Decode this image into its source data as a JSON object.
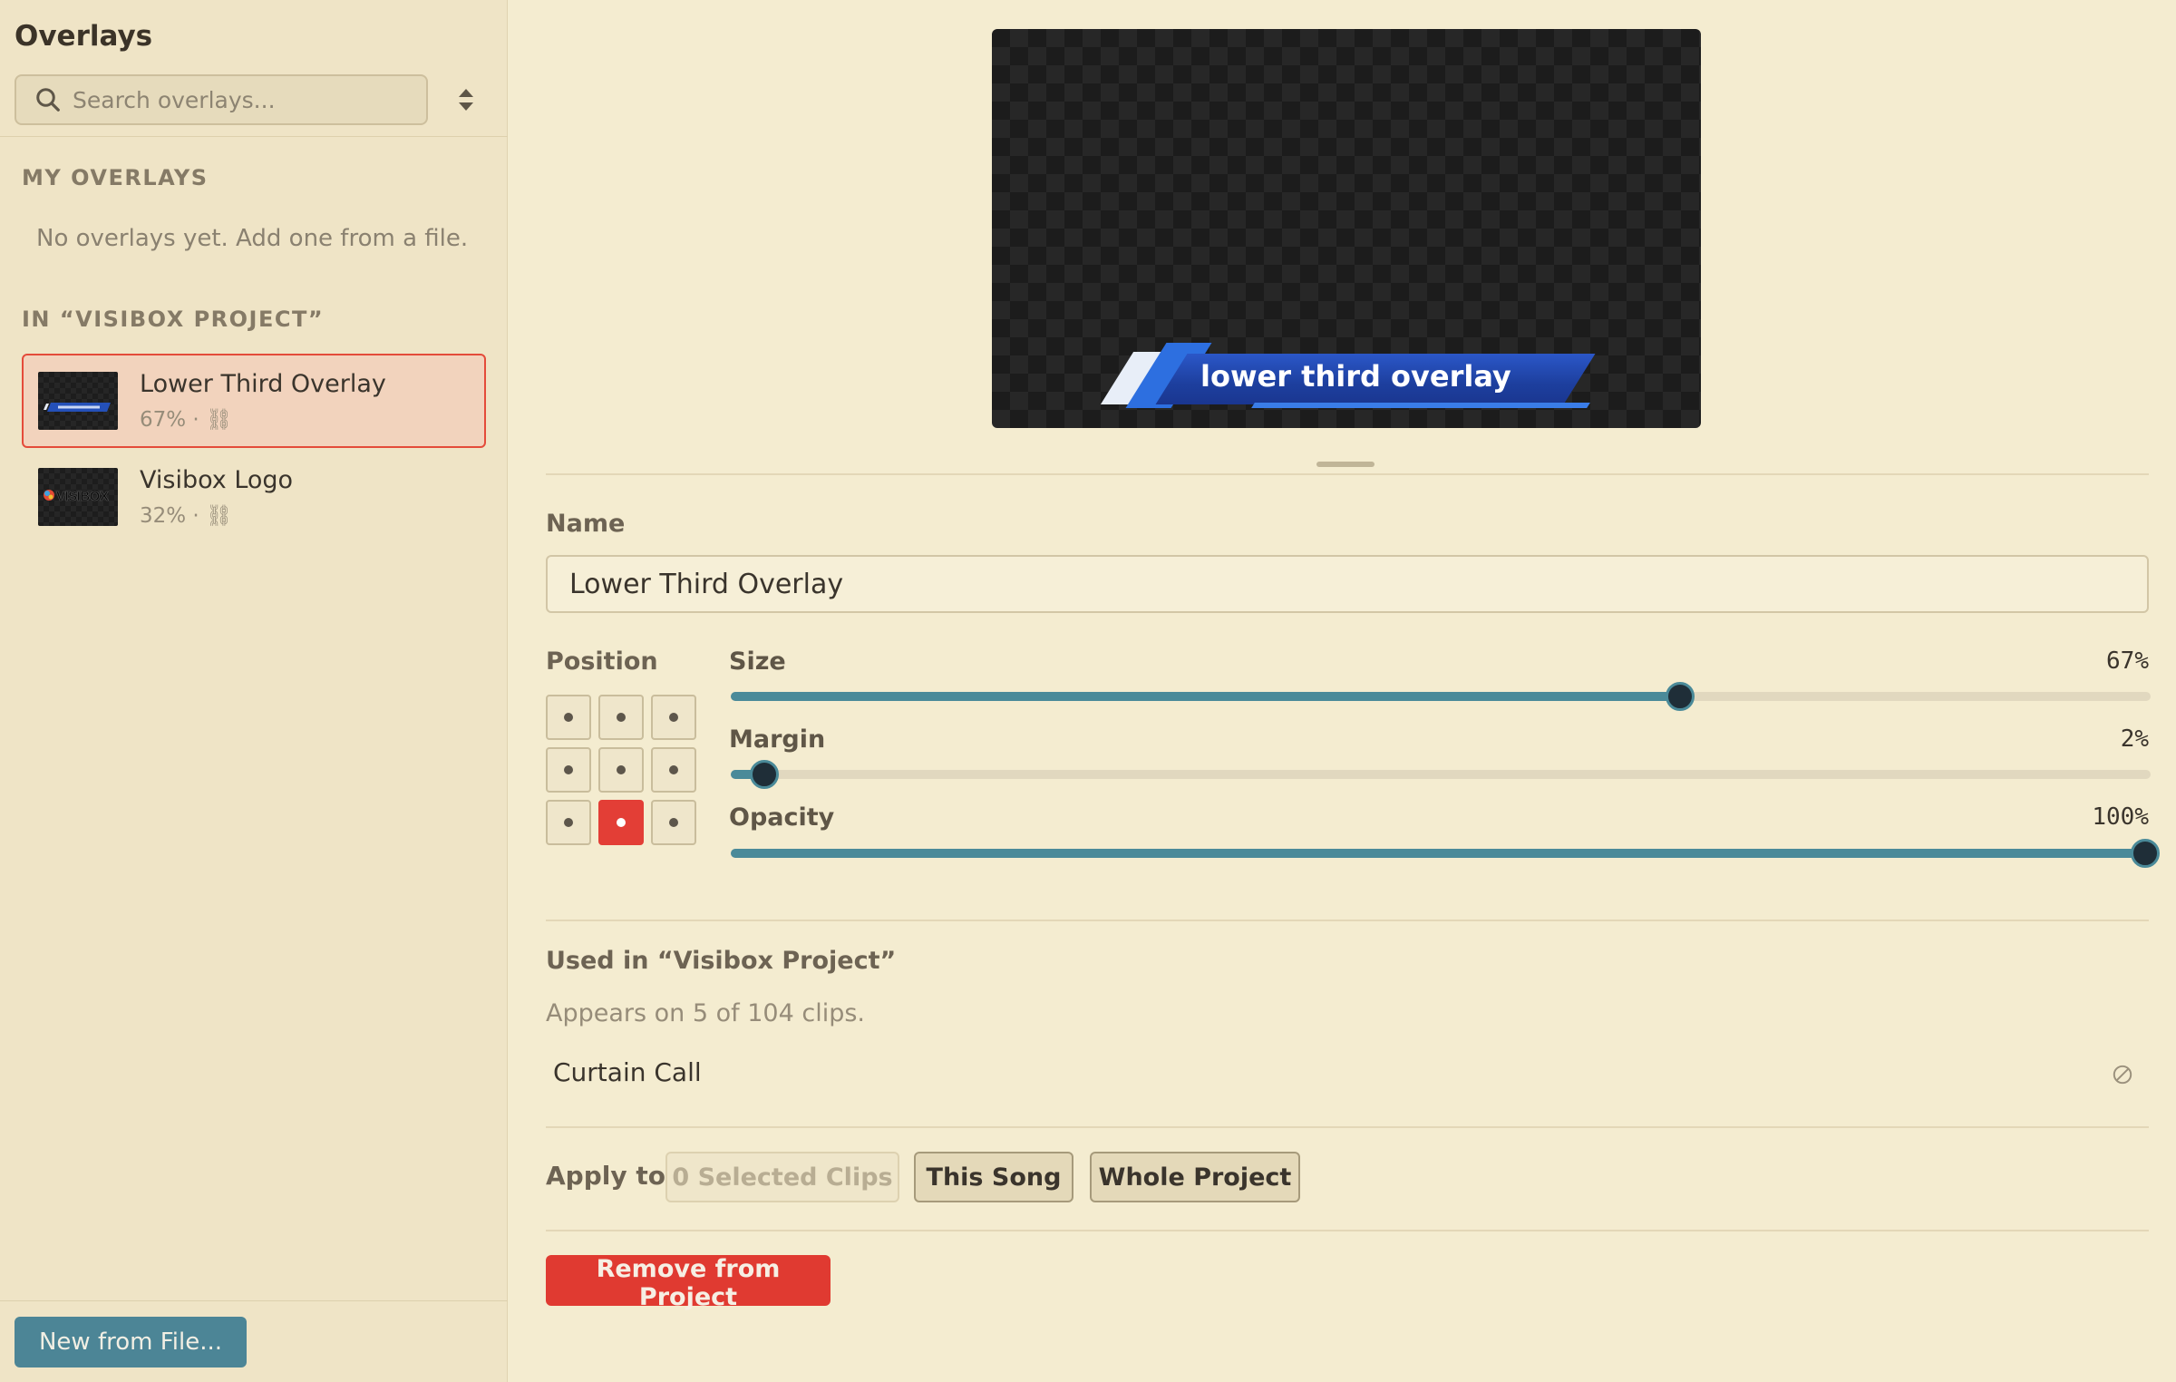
{
  "sidebar": {
    "title": "Overlays",
    "search_placeholder": "Search overlays...",
    "my_overlays_label": "MY OVERLAYS",
    "empty_message": "No overlays yet. Add one from a file.",
    "project_section_label": "IN “VISIBOX PROJECT”",
    "items": [
      {
        "name": "Lower Third Overlay",
        "meta": "67% · ⛓",
        "selected": true
      },
      {
        "name": "Visibox Logo",
        "meta": "32% · ⛓",
        "selected": false
      }
    ],
    "thumb_logo_text": "VISIBOX",
    "new_button": "New from File..."
  },
  "preview": {
    "overlay_text": "lower third overlay"
  },
  "editor": {
    "name_label": "Name",
    "name_value": "Lower Third Overlay",
    "position_label": "Position",
    "position_selected": "bottom-center",
    "size_label": "Size",
    "size_value": "67%",
    "size_fraction": 0.67,
    "margin_label": "Margin",
    "margin_value": "2%",
    "margin_fraction": 0.02,
    "opacity_label": "Opacity",
    "opacity_value": "100%",
    "opacity_fraction": 1.0
  },
  "usage": {
    "title": "Used in “Visibox Project”",
    "description": "Appears on 5 of 104 clips.",
    "clips": [
      "Curtain Call"
    ]
  },
  "apply": {
    "label": "Apply to",
    "selected_clips": "0 Selected Clips",
    "this_song": "This Song",
    "whole_project": "Whole Project"
  },
  "remove_button": "Remove from Project",
  "colors": {
    "accent_red": "#e33e36",
    "accent_teal": "#4a8a99",
    "background": "#f4ecd0",
    "sidebar_bg": "#efe4c6"
  }
}
